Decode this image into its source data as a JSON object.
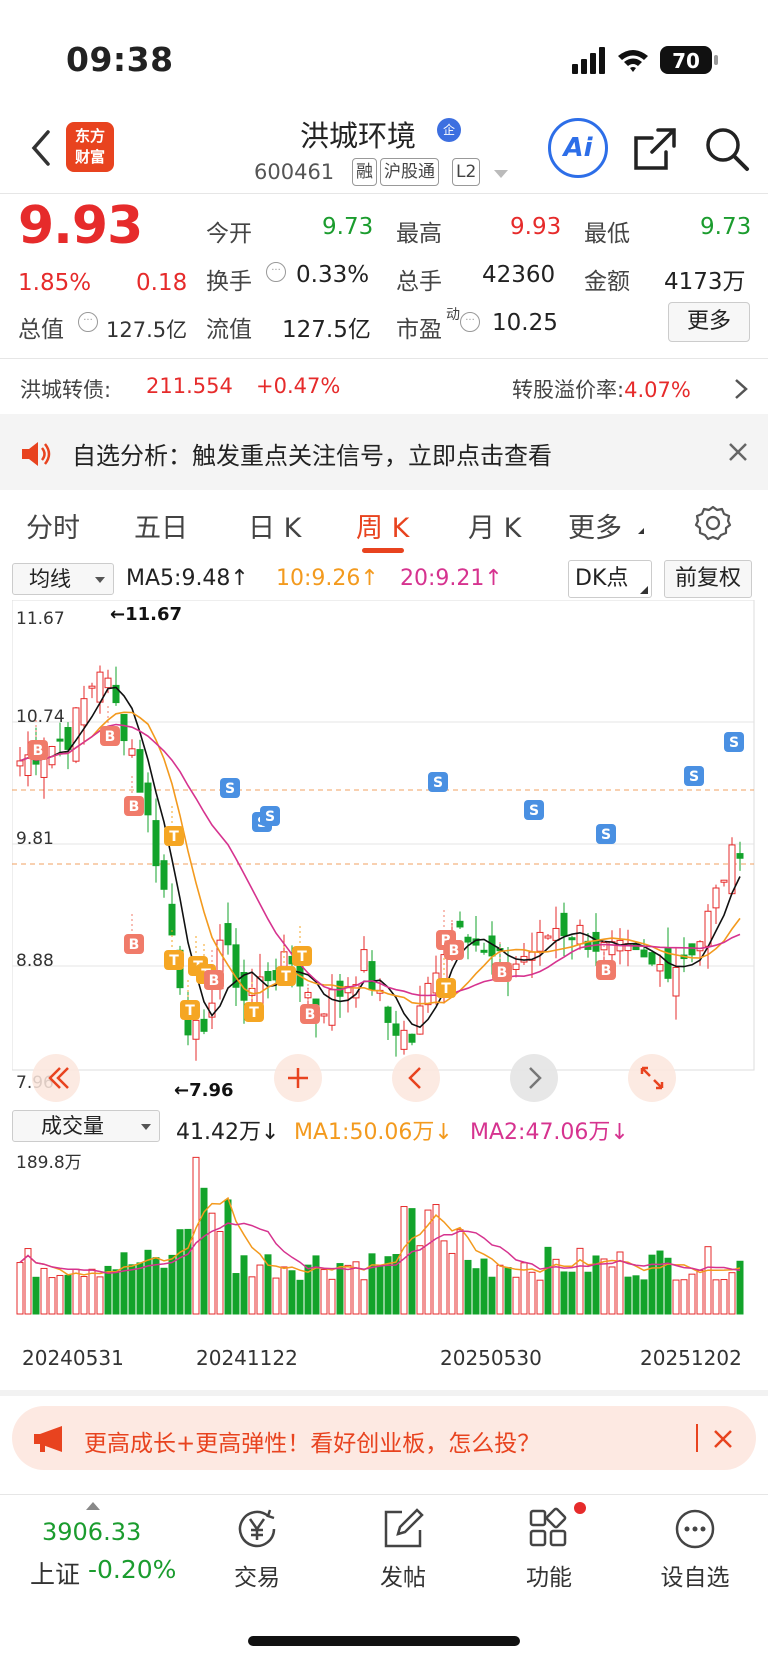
{
  "status": {
    "time": "09:38",
    "battery": "70"
  },
  "header": {
    "logo_line1": "东方",
    "logo_line2": "财富",
    "stock_name": "洪城环境",
    "badge": "企",
    "code": "600461",
    "tags": [
      "融",
      "沪股通",
      "L2"
    ],
    "ai_label": "Ai"
  },
  "quote": {
    "price": "9.93",
    "change_pct": "1.85%",
    "change": "0.18",
    "market_cap_label": "总值",
    "market_cap": "127.5亿",
    "open_label": "今开",
    "open": "9.73",
    "high_label": "最高",
    "high": "9.93",
    "low_label": "最低",
    "low": "9.73",
    "turnover_label": "换手",
    "turnover": "0.33%",
    "volume_label": "总手",
    "volume": "42360",
    "amount_label": "金额",
    "amount": "4173万",
    "float_label": "流值",
    "float_cap": "127.5亿",
    "pe_label": "市盈",
    "pe_sup": "动",
    "pe": "10.25",
    "more": "更多"
  },
  "convertible": {
    "label": "洪城转债:",
    "value": "211.554",
    "change": "+0.47%",
    "premium_label": "转股溢价率:",
    "premium": "4.07%"
  },
  "notice": {
    "text": "自选分析：触发重点关注信号，立即点击查看"
  },
  "tabs": [
    {
      "label": "分时"
    },
    {
      "label": "五日"
    },
    {
      "label": "日 K"
    },
    {
      "label": "周 K"
    },
    {
      "label": "月 K"
    },
    {
      "label": "更多"
    }
  ],
  "indicator": {
    "selector": "均线",
    "ma5": "MA5:9.48↑",
    "ma10": "10:9.26↑",
    "ma20": "20:9.21↑",
    "dk": "DK点",
    "adjust": "前复权"
  },
  "kline": {
    "ymax_label": "11.67",
    "y2_label": "10.74",
    "y3_label": "9.81",
    "y4_label": "8.88",
    "ymin_label": "7.96",
    "high_marker": "←11.67",
    "low_marker": "←7.96",
    "colors": {
      "up": "#e62b2b",
      "down": "#13a32b",
      "ma5": "#111111",
      "ma10": "#f39a1e",
      "ma20": "#d6338f",
      "b_signal": "#f07b6a",
      "t_signal": "#f5a623",
      "s_signal": "#4a90e2"
    }
  },
  "volume": {
    "selector": "成交量",
    "now": "41.42万↓",
    "ma1": "MA1:50.06万↓",
    "ma2": "MA2:47.06万↓",
    "ymax_label": "189.8万"
  },
  "dates": [
    "20240531",
    "20241122",
    "20250530",
    "20251202"
  ],
  "promo": {
    "text": "更高成长+更高弹性！看好创业板，怎么投？"
  },
  "bottom": {
    "index_value": "3906.33",
    "index_label": "上证",
    "index_change": "-0.20%",
    "nav": [
      {
        "label": "交易",
        "icon": "yen-icon"
      },
      {
        "label": "发帖",
        "icon": "edit-icon"
      },
      {
        "label": "功能",
        "icon": "grid-icon"
      },
      {
        "label": "设自选",
        "icon": "more-dots-icon"
      }
    ]
  }
}
